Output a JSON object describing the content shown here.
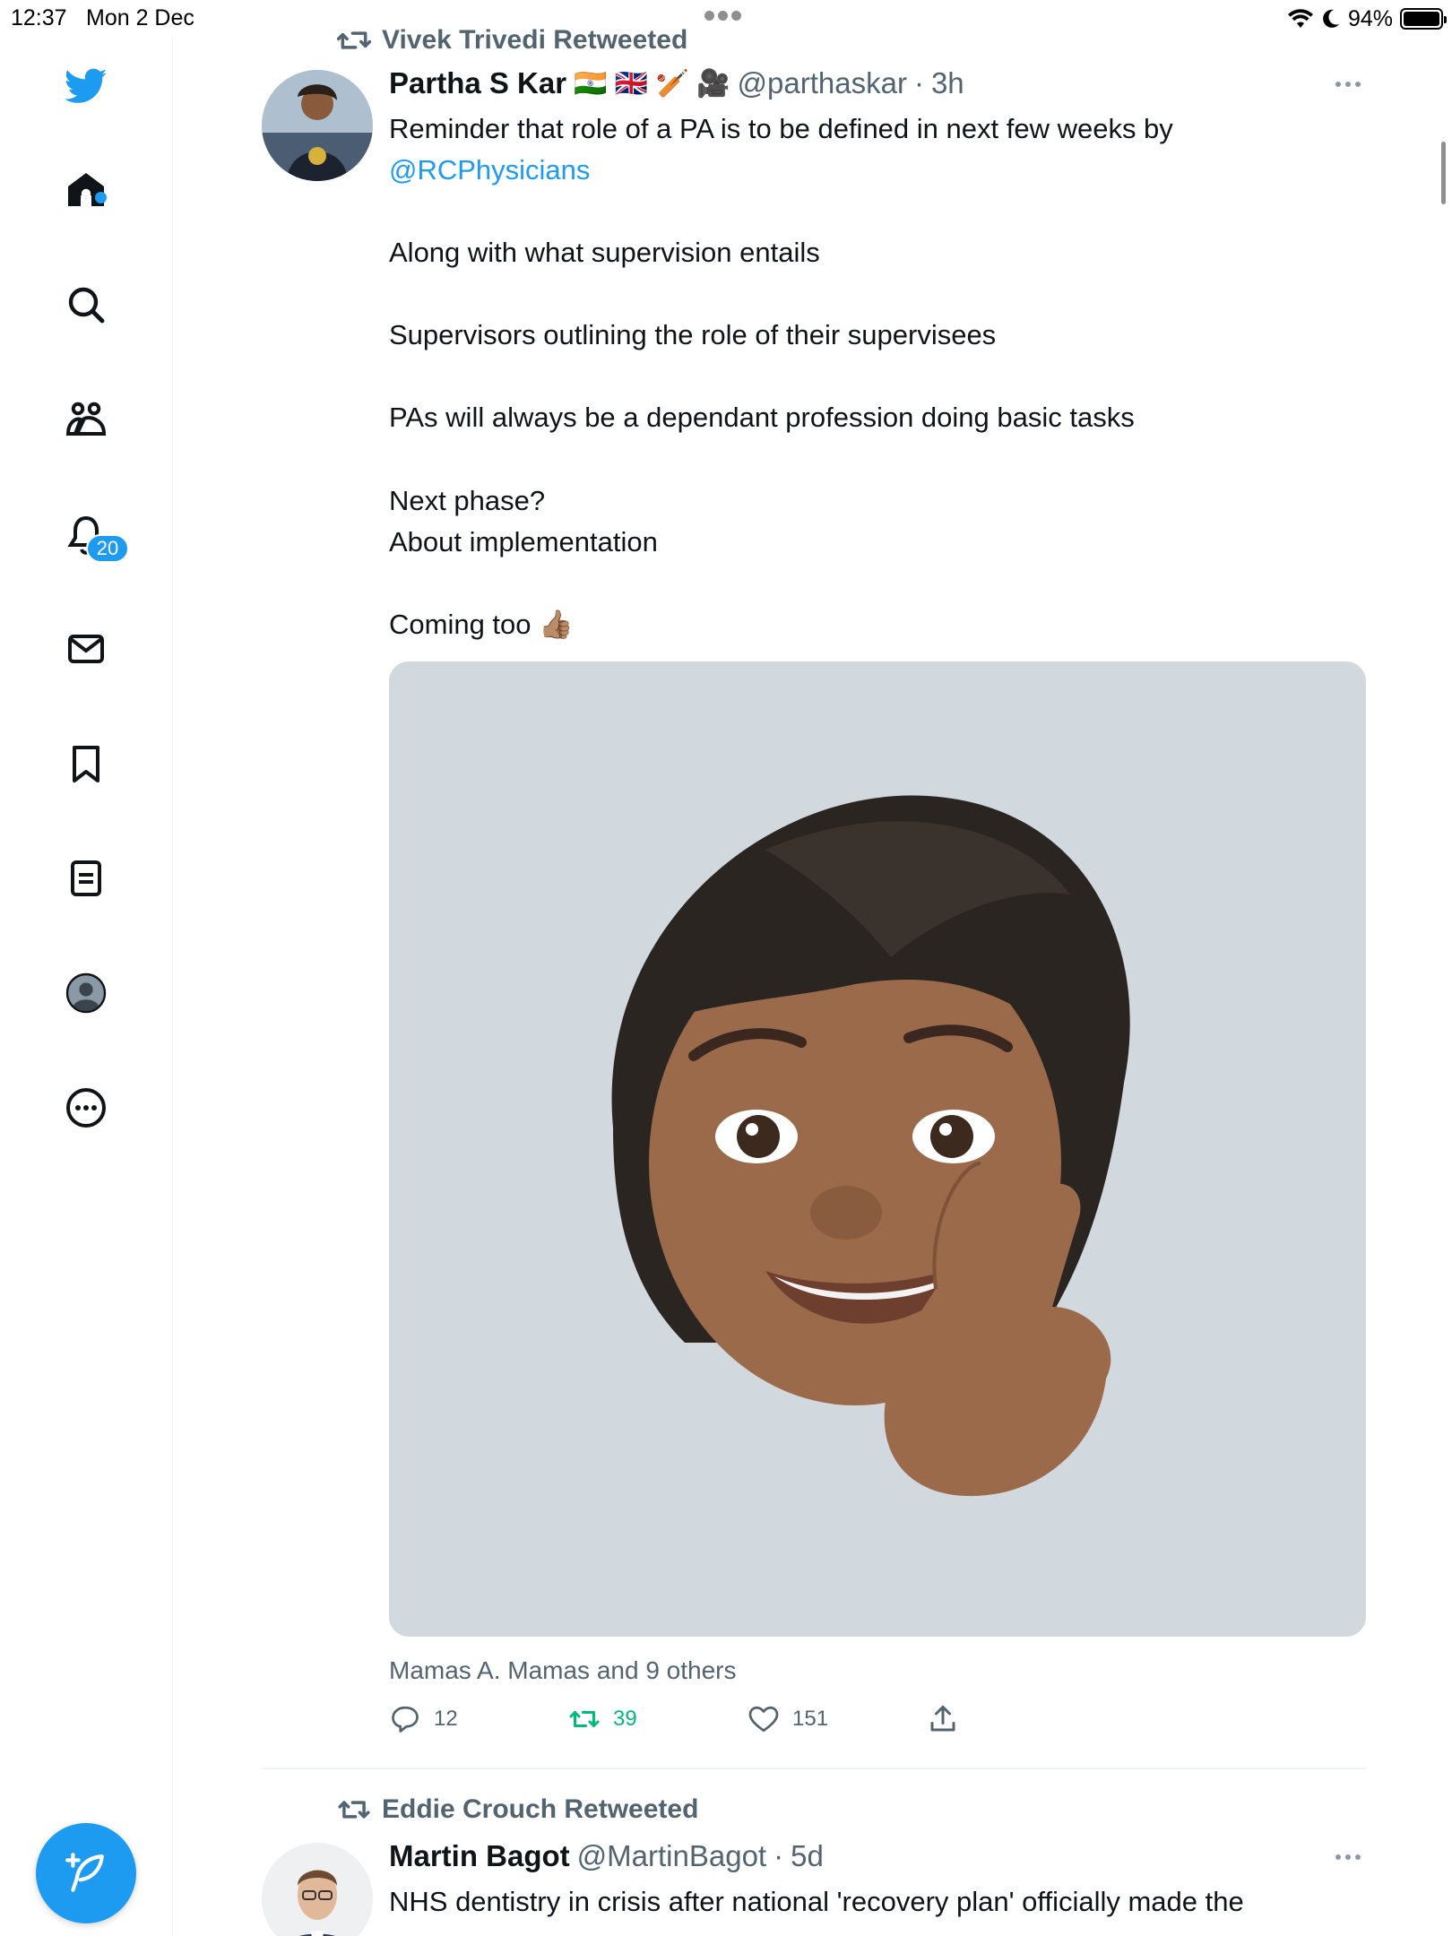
{
  "status_bar": {
    "time": "12:37",
    "date": "Mon 2 Dec",
    "battery": "94%"
  },
  "sidebar": {
    "notifications_badge": "20",
    "items": [
      {
        "name": "twitter-logo"
      },
      {
        "name": "home"
      },
      {
        "name": "search"
      },
      {
        "name": "communities"
      },
      {
        "name": "notifications"
      },
      {
        "name": "messages"
      },
      {
        "name": "bookmarks"
      },
      {
        "name": "lists"
      },
      {
        "name": "profile"
      },
      {
        "name": "more"
      }
    ],
    "accent_color": "#1d9bf0"
  },
  "tweet1": {
    "retweeted_by": "Vivek Trivedi Retweeted",
    "name": "Partha S Kar",
    "name_emojis": "🇮🇳 🇬🇧 🏏 🎥",
    "handle": "@parthaskar",
    "separator": "·",
    "time": "3h",
    "text_line1": "Reminder that role of a PA is to be defined in next few weeks by",
    "mention": "@RCPhysicians",
    "paragraph2": "Along with what supervision entails",
    "paragraph3": "Supervisors outlining the role of their supervisees",
    "paragraph4": "PAs will always be a dependant profession doing basic tasks",
    "paragraph5_line1": "Next phase?",
    "paragraph5_line2": "About implementation",
    "paragraph6": "Coming too 👍🏽",
    "likers": "Mamas A. Mamas and 9 others",
    "replies": "12",
    "retweets": "39",
    "likes": "151"
  },
  "tweet2": {
    "retweeted_by": "Eddie Crouch Retweeted",
    "name": "Martin Bagot",
    "handle": "@MartinBagot",
    "separator": "·",
    "time": "5d",
    "text_line1": "NHS dentistry in crisis after national 'recovery plan' officially made the"
  }
}
